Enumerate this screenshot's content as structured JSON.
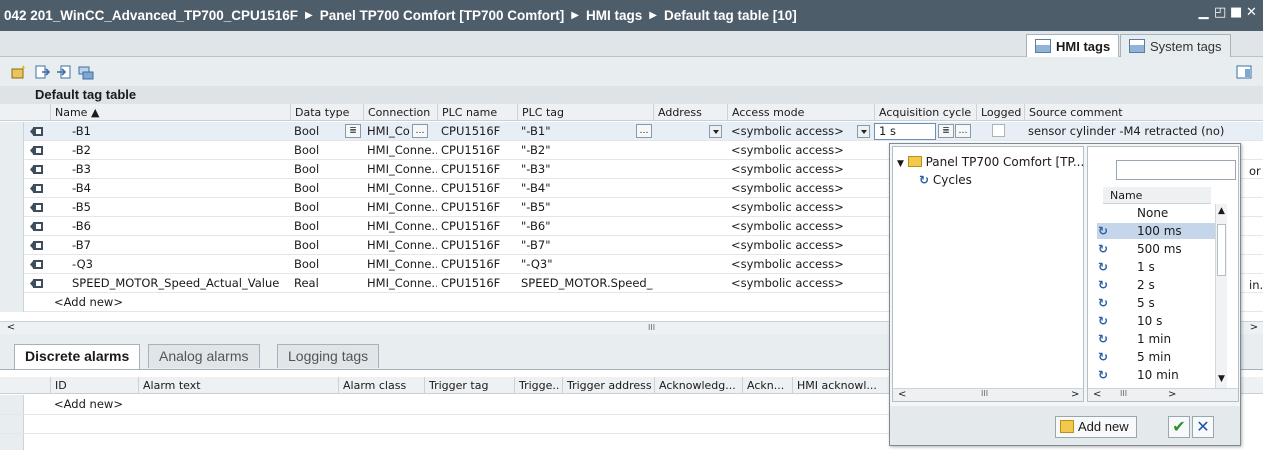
{
  "breadcrumb": [
    "042 201_WinCC_Advanced_TP700_CPU1516F",
    "Panel TP700 Comfort [TP700 Comfort]",
    "HMI tags",
    "Default tag table [10]"
  ],
  "top_tabs": {
    "hmi_tags": "HMI tags",
    "system_tags": "System tags"
  },
  "table": {
    "title": "Default tag table",
    "headers": {
      "name": "Name ▲",
      "datatype": "Data type",
      "connection": "Connection",
      "plcname": "PLC name",
      "plctag": "PLC tag",
      "address": "Address",
      "access": "Access mode",
      "acq": "Acquisition cycle",
      "logged": "Logged",
      "comment": "Source comment"
    },
    "rows": [
      {
        "name": "-B1",
        "datatype": "Bool",
        "connection": "HMI_Co",
        "plcname": "CPU1516F",
        "plctag": "\"-B1\"",
        "access": "<symbolic access>",
        "acq": "1 s",
        "comment": "sensor cylinder -M4 retracted (no)"
      },
      {
        "name": "-B2",
        "datatype": "Bool",
        "connection": "HMI_Conne..",
        "plcname": "CPU1516F",
        "plctag": "\"-B2\"",
        "access": "<symbolic access>"
      },
      {
        "name": "-B3",
        "datatype": "Bool",
        "connection": "HMI_Conne..",
        "plcname": "CPU1516F",
        "plctag": "\"-B3\"",
        "access": "<symbolic access>"
      },
      {
        "name": "-B4",
        "datatype": "Bool",
        "connection": "HMI_Conne..",
        "plcname": "CPU1516F",
        "plctag": "\"-B4\"",
        "access": "<symbolic access>"
      },
      {
        "name": "-B5",
        "datatype": "Bool",
        "connection": "HMI_Conne..",
        "plcname": "CPU1516F",
        "plctag": "\"-B5\"",
        "access": "<symbolic access>"
      },
      {
        "name": "-B6",
        "datatype": "Bool",
        "connection": "HMI_Conne..",
        "plcname": "CPU1516F",
        "plctag": "\"-B6\"",
        "access": "<symbolic access>"
      },
      {
        "name": "-B7",
        "datatype": "Bool",
        "connection": "HMI_Conne..",
        "plcname": "CPU1516F",
        "plctag": "\"-B7\"",
        "access": "<symbolic access>"
      },
      {
        "name": "-Q3",
        "datatype": "Bool",
        "connection": "HMI_Conne..",
        "plcname": "CPU1516F",
        "plctag": "\"-Q3\"",
        "access": "<symbolic access>"
      },
      {
        "name": "SPEED_MOTOR_Speed_Actual_Value",
        "datatype": "Real",
        "connection": "HMI_Conne..",
        "plcname": "CPU1516F",
        "plctag": "SPEED_MOTOR.Speed_",
        "access": "<symbolic access>"
      }
    ],
    "add_new": "<Add new>",
    "side_fragments": [
      "or",
      "in."
    ],
    "scroll_thumb": "III"
  },
  "bottom": {
    "tabs": [
      "Discrete alarms",
      "Analog alarms",
      "Logging tags"
    ],
    "headers": [
      "ID",
      "Alarm text",
      "Alarm class",
      "Trigger tag",
      "Trigge..",
      "Trigger address",
      "Acknowledg...",
      "Ackn...",
      "HMI acknowl..."
    ],
    "add_new": "<Add new>"
  },
  "popup": {
    "tree_root": "Panel TP700 Comfort [TP...",
    "tree_child": "Cycles",
    "list_header": "Name",
    "items": [
      "None",
      "100 ms",
      "500 ms",
      "1 s",
      "2 s",
      "5 s",
      "10 s",
      "1 min",
      "5 min",
      "10 min"
    ],
    "selected_index": 1,
    "add_new": "Add new",
    "scroll_thumb": "III"
  },
  "colors": {
    "titlebar": "#4e5d6a",
    "selection": "#c5d6ea",
    "ok": "#2f8f2f",
    "cancel": "#1b4fb3"
  }
}
